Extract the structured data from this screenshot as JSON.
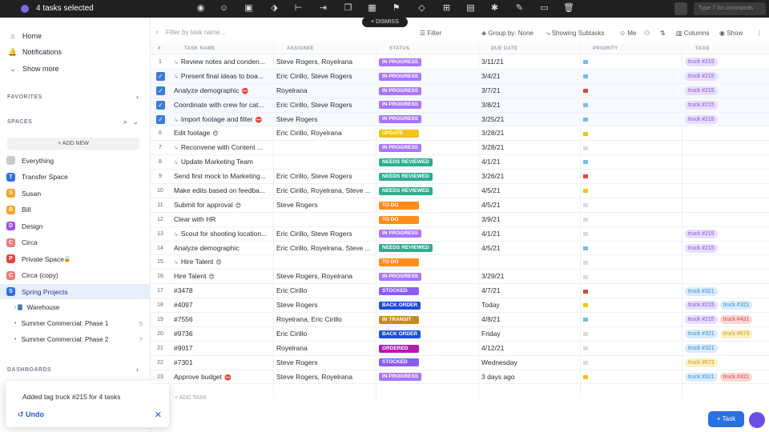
{
  "topbar": {
    "selection_label": "4 tasks selected",
    "command_placeholder": "Type '/' for commands",
    "dismiss_label": "× DISMISS"
  },
  "sidebar": {
    "nav": [
      {
        "label": "Home",
        "icon": "home-icon"
      },
      {
        "label": "Notifications",
        "icon": "bell-icon"
      },
      {
        "label": "Show more",
        "icon": "chevron-down-icon"
      }
    ],
    "favorites_label": "FAVORITES",
    "spaces_label": "SPACES",
    "add_new_label": "+ ADD NEW",
    "spaces": [
      {
        "label": "Everything",
        "letter": "",
        "color": "#c7c9ce"
      },
      {
        "label": "Transfer Space",
        "letter": "T",
        "color": "#2f6fe4"
      },
      {
        "label": "Susan",
        "letter": "S",
        "color": "#f5a623"
      },
      {
        "label": "Bill",
        "letter": "B",
        "color": "#f5a623"
      },
      {
        "label": "Design",
        "letter": "D",
        "color": "#9b51e0"
      },
      {
        "label": "Circa",
        "letter": "C",
        "color": "#f07b7b"
      },
      {
        "label": "Private Space",
        "letter": "P",
        "color": "#e2463f"
      },
      {
        "label": "Circa (copy)",
        "letter": "C",
        "color": "#f07b7b"
      },
      {
        "label": "Spring Projects",
        "letter": "S",
        "color": "#2f6fe4"
      }
    ],
    "folders": [
      {
        "label": "Warehouse",
        "count": ""
      },
      {
        "label": "Summer Commercial: Phase 1",
        "count": "5"
      },
      {
        "label": "Summer Commercial: Phase 2",
        "count": "7"
      }
    ],
    "dashboards_label": "DASHBOARDS"
  },
  "toast": {
    "message": "Added tag truck #215 for 4 tasks",
    "undo_label": "Undo"
  },
  "toolbar": {
    "search_placeholder": "Filter by task name...",
    "filter_label": "Filter",
    "group_label": "Group by: None",
    "subtasks_label": "Showing Subtasks",
    "me_label": "Me",
    "columns_label": "Columns",
    "show_label": "Show"
  },
  "columns": {
    "num": "#",
    "name": "TASK NAME",
    "assignee": "ASSIGNEE",
    "status": "STATUS",
    "due": "DUE DATE",
    "priority": "PRIORITY",
    "tags": "TAGS"
  },
  "colors": {
    "IN PROGRESS": "#a875ff",
    "UPDATE": "#f4c21a",
    "NEEDS REVIEWED": "#2bae8e",
    "TO DO": "#ff8c1a",
    "STOCKED": "#8b5cf6",
    "BACK ORDER": "#1d4ed8",
    "IN TRANSIT": "#c98a1b",
    "ORDERED": "#b21bb2"
  },
  "rows": [
    {
      "n": "1",
      "checked": false,
      "sub": true,
      "name": "Review notes and conden...",
      "assignee": "Steve Rogers, Royelrana",
      "status": "IN PROGRESS",
      "due": "3/11/21",
      "flag": "#7db9e8",
      "tags": [
        {
          "t": "truck #215",
          "bg": "#e8dcff",
          "fg": "#7b57d6"
        }
      ]
    },
    {
      "n": "2",
      "checked": true,
      "sub": true,
      "name": "Present final ideas to boa...",
      "assignee": "Eric Cirillo, Steve Rogers",
      "status": "IN PROGRESS",
      "due": "3/4/21",
      "flag": "#7db9e8",
      "tags": [
        {
          "t": "truck #215",
          "bg": "#e8dcff",
          "fg": "#7b57d6"
        }
      ]
    },
    {
      "n": "3",
      "checked": true,
      "sub": false,
      "name": "Analyze demographic",
      "emoji": "⛔",
      "assignee": "Royelrana",
      "status": "IN PROGRESS",
      "due": "3/7/21",
      "flag": "#e2463f",
      "tags": [
        {
          "t": "truck #215",
          "bg": "#e8dcff",
          "fg": "#7b57d6"
        }
      ]
    },
    {
      "n": "4",
      "checked": true,
      "sub": false,
      "name": "Coordinate with crew for cat...",
      "assignee": "Eric Cirillo, Steve Rogers",
      "status": "IN PROGRESS",
      "due": "3/8/21",
      "flag": "#7db9e8",
      "tags": [
        {
          "t": "truck #215",
          "bg": "#e8dcff",
          "fg": "#7b57d6"
        }
      ]
    },
    {
      "n": "5",
      "checked": true,
      "sub": true,
      "name": "Import footage and filter",
      "emoji": "⛔",
      "assignee": "Steve Rogers",
      "status": "IN PROGRESS",
      "due": "3/25/21",
      "flag": "#7db9e8",
      "tags": [
        {
          "t": "truck #215",
          "bg": "#e8dcff",
          "fg": "#7b57d6"
        }
      ]
    },
    {
      "n": "6",
      "checked": false,
      "sub": false,
      "name": "Edit footage",
      "emoji": "😊",
      "assignee": "Eric Cirillo, Royelrana",
      "status": "UPDATE",
      "due": "3/28/21",
      "flag": "#f4c21a",
      "tags": []
    },
    {
      "n": "7",
      "checked": false,
      "sub": true,
      "name": "Reconvene with Content ...",
      "assignee": "",
      "status": "IN PROGRESS",
      "due": "3/28/21",
      "flag": "#d8dbe0",
      "tags": []
    },
    {
      "n": "8",
      "checked": false,
      "sub": true,
      "name": "Update Marketing Team",
      "assignee": "",
      "status": "NEEDS REVIEWED",
      "due": "4/1/21",
      "flag": "#7db9e8",
      "tags": []
    },
    {
      "n": "9",
      "checked": false,
      "sub": false,
      "name": "Send first mock to Marketing...",
      "assignee": "Eric Cirillo, Steve Rogers",
      "status": "NEEDS REVIEWED",
      "due": "3/26/21",
      "flag": "#e2463f",
      "tags": []
    },
    {
      "n": "10",
      "checked": false,
      "sub": false,
      "name": "Make edits based on feedba...",
      "assignee": "Eric Cirillo, Royelrana, Steve ...",
      "status": "NEEDS REVIEWED",
      "due": "4/5/21",
      "flag": "#f4c21a",
      "tags": []
    },
    {
      "n": "11",
      "checked": false,
      "sub": false,
      "name": "Submit for approval",
      "emoji": "😊",
      "assignee": "Steve Rogers",
      "status": "TO DO",
      "due": "4/5/21",
      "flag": "#d8dbe0",
      "tags": []
    },
    {
      "n": "12",
      "checked": false,
      "sub": false,
      "name": "Clear with HR",
      "assignee": "",
      "status": "TO DO",
      "due": "3/9/21",
      "flag": "#d8dbe0",
      "tags": []
    },
    {
      "n": "13",
      "checked": false,
      "sub": true,
      "name": "Scout for shooting location...",
      "assignee": "Eric Cirillo, Steve Rogers",
      "status": "IN PROGRESS",
      "due": "4/1/21",
      "flag": "#d8dbe0",
      "tags": [
        {
          "t": "truck #215",
          "bg": "#e8dcff",
          "fg": "#7b57d6"
        }
      ]
    },
    {
      "n": "14",
      "checked": false,
      "sub": false,
      "name": "Analyze demographic",
      "assignee": "Eric Cirillo, Royelrana, Steve ...",
      "status": "NEEDS REVIEWED",
      "due": "4/5/21",
      "flag": "#7db9e8",
      "tags": [
        {
          "t": "truck #215",
          "bg": "#e8dcff",
          "fg": "#7b57d6"
        }
      ]
    },
    {
      "n": "15",
      "checked": false,
      "sub": true,
      "name": "Hire Talent",
      "emoji": "😊",
      "assignee": "",
      "status": "TO DO",
      "due": "",
      "flag": "#d8dbe0",
      "tags": []
    },
    {
      "n": "16",
      "checked": false,
      "sub": false,
      "name": "Hire Talent",
      "emoji": "😊",
      "assignee": "Steve Rogers, Royelrana",
      "status": "IN PROGRESS",
      "due": "3/29/21",
      "flag": "#d8dbe0",
      "tags": []
    },
    {
      "n": "17",
      "checked": false,
      "sub": false,
      "name": "#3478",
      "assignee": "Eric Cirillo",
      "status": "STOCKED",
      "due": "4/7/21",
      "flag": "#e2463f",
      "tags": [
        {
          "t": "truck #321",
          "bg": "#d8ecfb",
          "fg": "#3a8ad4"
        }
      ]
    },
    {
      "n": "18",
      "checked": false,
      "sub": false,
      "name": "#4097",
      "assignee": "Steve Rogers",
      "status": "BACK ORDER",
      "due": "Today",
      "flag": "#f4c21a",
      "tags": [
        {
          "t": "truck #215",
          "bg": "#e8dcff",
          "fg": "#7b57d6"
        },
        {
          "t": "truck #321",
          "bg": "#d8ecfb",
          "fg": "#3a8ad4"
        }
      ]
    },
    {
      "n": "19",
      "checked": false,
      "sub": false,
      "name": "#7556",
      "assignee": "Royelrana, Eric Cirillo",
      "status": "IN TRANSIT",
      "due": "4/8/21",
      "flag": "#7db9e8",
      "tags": [
        {
          "t": "truck #215",
          "bg": "#e8dcff",
          "fg": "#7b57d6"
        },
        {
          "t": "truck #421",
          "bg": "#fbd8d4",
          "fg": "#d9483b"
        }
      ]
    },
    {
      "n": "20",
      "checked": false,
      "sub": false,
      "name": "#9736",
      "assignee": "Eric Cirillo",
      "status": "BACK ORDER",
      "due": "Friday",
      "flag": "#d8dbe0",
      "tags": [
        {
          "t": "truck #321",
          "bg": "#d8ecfb",
          "fg": "#3a8ad4"
        },
        {
          "t": "truck #673",
          "bg": "#fdf0c4",
          "fg": "#c99a12"
        }
      ]
    },
    {
      "n": "21",
      "checked": false,
      "sub": false,
      "name": "#9017",
      "assignee": "Royelrana",
      "status": "ORDERED",
      "due": "4/12/21",
      "flag": "#d8dbe0",
      "tags": [
        {
          "t": "truck #321",
          "bg": "#d8ecfb",
          "fg": "#3a8ad4"
        }
      ]
    },
    {
      "n": "22",
      "checked": false,
      "sub": false,
      "name": "#7301",
      "assignee": "Steve Rogers",
      "status": "STOCKED",
      "due": "Wednesday",
      "flag": "#d8dbe0",
      "tags": [
        {
          "t": "truck #673",
          "bg": "#fdf0c4",
          "fg": "#c99a12"
        }
      ]
    },
    {
      "n": "23",
      "checked": false,
      "sub": false,
      "name": "Approve budget",
      "emoji": "⛔",
      "assignee": "Steve Rogers, Royelrana",
      "status": "IN PROGRESS",
      "due": "3 days ago",
      "flag": "#f4c21a",
      "tags": [
        {
          "t": "truck #321",
          "bg": "#d8ecfb",
          "fg": "#3a8ad4"
        },
        {
          "t": "truck #421",
          "bg": "#fbd8d4",
          "fg": "#d9483b"
        }
      ]
    }
  ],
  "add_task_label": "+ ADD TASK",
  "fab_label": "+ Task"
}
